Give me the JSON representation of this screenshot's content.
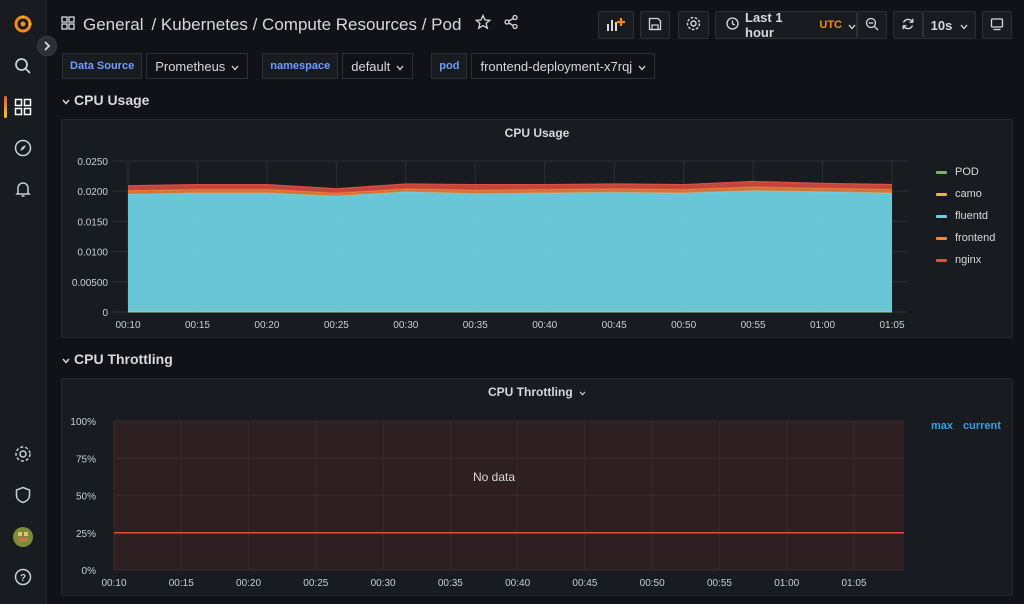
{
  "breadcrumb": {
    "folder": "General",
    "path": "/ Kubernetes / Compute Resources / Pod"
  },
  "toolbar": {
    "time_range": "Last 1 hour",
    "timezone": "UTC",
    "refresh_interval": "10s"
  },
  "variables": [
    {
      "label": "Data Source",
      "value": "Prometheus"
    },
    {
      "label": "namespace",
      "value": "default"
    },
    {
      "label": "pod",
      "value": "frontend-deployment-x7rqj"
    }
  ],
  "rows": {
    "cpu_usage": "CPU Usage",
    "cpu_throttling": "CPU Throttling"
  },
  "colors": {
    "pod": "#7eb26d",
    "camo": "#eab839",
    "fluentd": "#6ed0e0",
    "frontend": "#ef843c",
    "nginx": "#e24d42",
    "background": "#111217",
    "panel": "#181b1f"
  },
  "icons": [
    "grafana-logo",
    "search-icon",
    "dashboards-icon",
    "explore-icon",
    "alerting-icon",
    "configuration-icon",
    "server-admin-icon",
    "avatar",
    "help-icon",
    "apps-icon",
    "star-icon",
    "share-icon",
    "add-panel-icon",
    "save-icon",
    "settings-icon",
    "clock-icon",
    "zoom-out-icon",
    "refresh-icon",
    "tv-mode-icon"
  ],
  "panels": {
    "cpu_usage": {
      "title": "CPU Usage",
      "legend": [
        {
          "name": "POD",
          "color": "#7eb26d"
        },
        {
          "name": "camo",
          "color": "#eab839"
        },
        {
          "name": "fluentd",
          "color": "#6ed0e0"
        },
        {
          "name": "frontend",
          "color": "#ef843c"
        },
        {
          "name": "nginx",
          "color": "#e24d42"
        }
      ]
    },
    "cpu_throttling": {
      "title": "CPU Throttling",
      "no_data": "No data",
      "legend_headers": {
        "max": "max",
        "current": "current"
      }
    }
  },
  "chart_data": [
    {
      "type": "area",
      "title": "CPU Usage",
      "stacked": true,
      "x": [
        "00:10",
        "00:15",
        "00:20",
        "00:25",
        "00:30",
        "00:35",
        "00:40",
        "00:45",
        "00:50",
        "00:55",
        "01:00",
        "01:05"
      ],
      "ylim": [
        0,
        0.025
      ],
      "yticks": [
        "0",
        "0.00500",
        "0.0100",
        "0.0150",
        "0.0200",
        "0.0250"
      ],
      "grid": true,
      "legend_position": "right",
      "series": [
        {
          "name": "POD",
          "values": [
            0,
            0,
            0,
            0,
            0,
            0,
            0,
            0,
            0,
            0,
            0,
            0
          ]
        },
        {
          "name": "camo",
          "values": [
            0.0001,
            0.0001,
            0.0001,
            0.0001,
            0.0001,
            0.0001,
            0.0001,
            0.0001,
            0.0001,
            0.0001,
            0.0001,
            0.0001
          ]
        },
        {
          "name": "fluentd",
          "values": [
            0.0194,
            0.0196,
            0.0196,
            0.0191,
            0.0198,
            0.0195,
            0.0196,
            0.0197,
            0.0196,
            0.02,
            0.0198,
            0.0196
          ]
        },
        {
          "name": "frontend",
          "values": [
            0.0006,
            0.0006,
            0.0006,
            0.0005,
            0.0005,
            0.0006,
            0.0006,
            0.0006,
            0.0006,
            0.0006,
            0.0006,
            0.0006
          ]
        },
        {
          "name": "nginx",
          "values": [
            0.0008,
            0.0008,
            0.0008,
            0.0007,
            0.0008,
            0.0009,
            0.0008,
            0.0008,
            0.0008,
            0.0009,
            0.0008,
            0.0008
          ]
        }
      ]
    },
    {
      "type": "line",
      "title": "CPU Throttling",
      "x": [
        "00:10",
        "00:15",
        "00:20",
        "00:25",
        "00:30",
        "00:35",
        "00:40",
        "00:45",
        "00:50",
        "00:55",
        "01:00",
        "01:05"
      ],
      "ylim": [
        0,
        100
      ],
      "yticks": [
        "0%",
        "25%",
        "50%",
        "75%",
        "100%"
      ],
      "threshold": 25,
      "grid": true,
      "series": []
    }
  ]
}
